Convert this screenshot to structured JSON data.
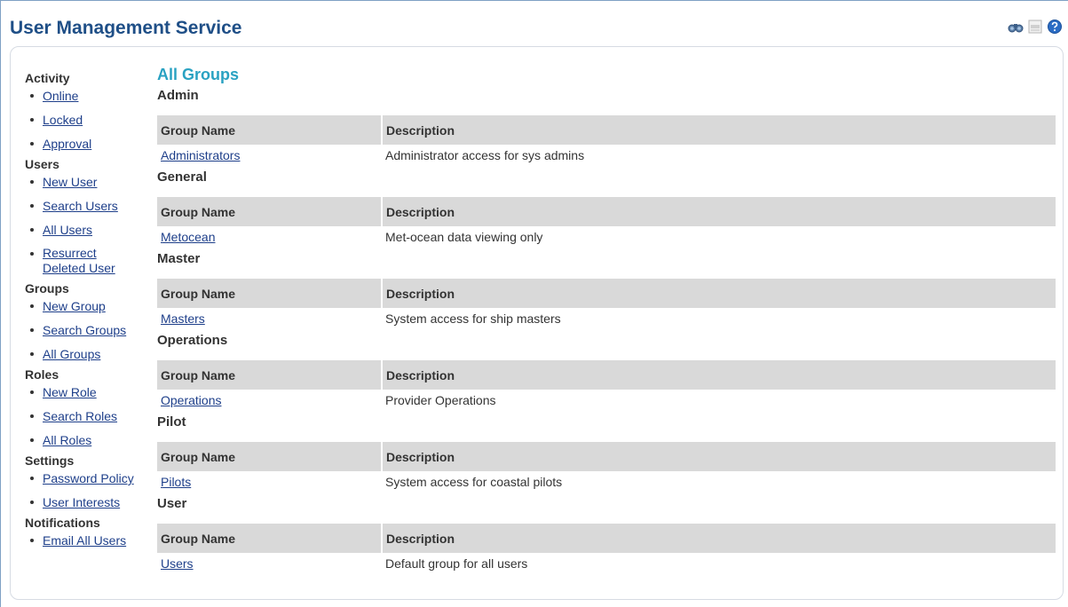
{
  "header": {
    "title": "User Management Service",
    "tools": [
      {
        "name": "binoculars-icon"
      },
      {
        "name": "pdf-icon"
      },
      {
        "name": "help-icon"
      }
    ]
  },
  "sidebar": {
    "sections": [
      {
        "heading": "Activity",
        "items": [
          "Online",
          "Locked",
          "Approval"
        ]
      },
      {
        "heading": "Users",
        "items": [
          "New User",
          "Search Users",
          "All Users",
          "Resurrect Deleted User"
        ]
      },
      {
        "heading": "Groups",
        "items": [
          "New Group",
          "Search Groups",
          "All Groups"
        ]
      },
      {
        "heading": "Roles",
        "items": [
          "New Role",
          "Search Roles",
          "All Roles"
        ]
      },
      {
        "heading": "Settings",
        "items": [
          "Password Policy",
          "User Interests"
        ]
      },
      {
        "heading": "Notifications",
        "items": [
          "Email All Users"
        ]
      }
    ]
  },
  "main": {
    "title": "All Groups",
    "columns": [
      "Group Name",
      "Description"
    ],
    "groups": [
      {
        "category": "Admin",
        "rows": [
          {
            "name": "Administrators",
            "description": "Administrator access for sys admins"
          }
        ]
      },
      {
        "category": "General",
        "rows": [
          {
            "name": "Metocean",
            "description": "Met-ocean data viewing only"
          }
        ]
      },
      {
        "category": "Master",
        "rows": [
          {
            "name": "Masters",
            "description": "System access for ship masters"
          }
        ]
      },
      {
        "category": "Operations",
        "rows": [
          {
            "name": "Operations",
            "description": "Provider Operations"
          }
        ]
      },
      {
        "category": "Pilot",
        "rows": [
          {
            "name": "Pilots",
            "description": "System access for coastal pilots"
          }
        ]
      },
      {
        "category": "User",
        "rows": [
          {
            "name": "Users",
            "description": "Default group for all users"
          }
        ]
      }
    ]
  },
  "colors": {
    "title": "#1f4f87",
    "accent": "#2aa2c2",
    "link": "#1e3f8a",
    "table_header": "#d9d9d9"
  }
}
